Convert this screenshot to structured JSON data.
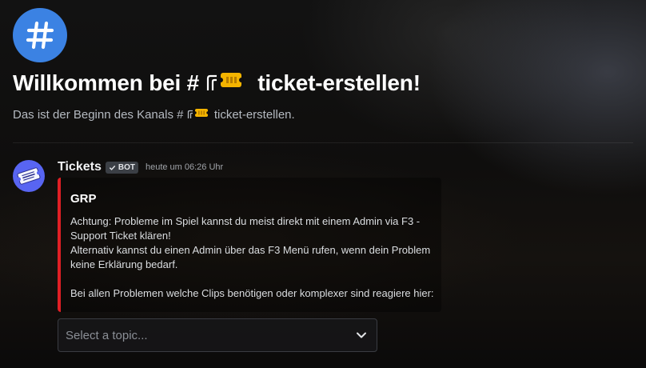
{
  "welcome": {
    "title_prefix": "Willkommen bei #",
    "channel_name": "ticket-erstellen!",
    "subtitle_prefix": "Das ist der Beginn des Kanals #",
    "subtitle_channel": "ticket-erstellen."
  },
  "message": {
    "author": "Tickets",
    "bot_tag": "BOT",
    "timestamp": "heute um 06:26 Uhr",
    "embed": {
      "accent_color": "#e01f25",
      "title": "GRP",
      "lines": [
        "Achtung: Probleme im Spiel kannst du meist direkt mit einem Admin via F3 -",
        "Support Ticket klären!",
        "Alternativ kannst du einen Admin über das F3 Menü rufen, wenn dein Problem",
        "keine Erklärung bedarf.",
        "",
        "Bei allen Problemen welche Clips benötigen oder komplexer sind reagiere hier:"
      ]
    },
    "select": {
      "placeholder": "Select a topic..."
    }
  },
  "icons": {
    "channel": "hash-icon",
    "ticket_emoji": "ticket-emoji-icon",
    "select_chevron": "chevron-down-icon",
    "bot_check": "check-icon"
  }
}
